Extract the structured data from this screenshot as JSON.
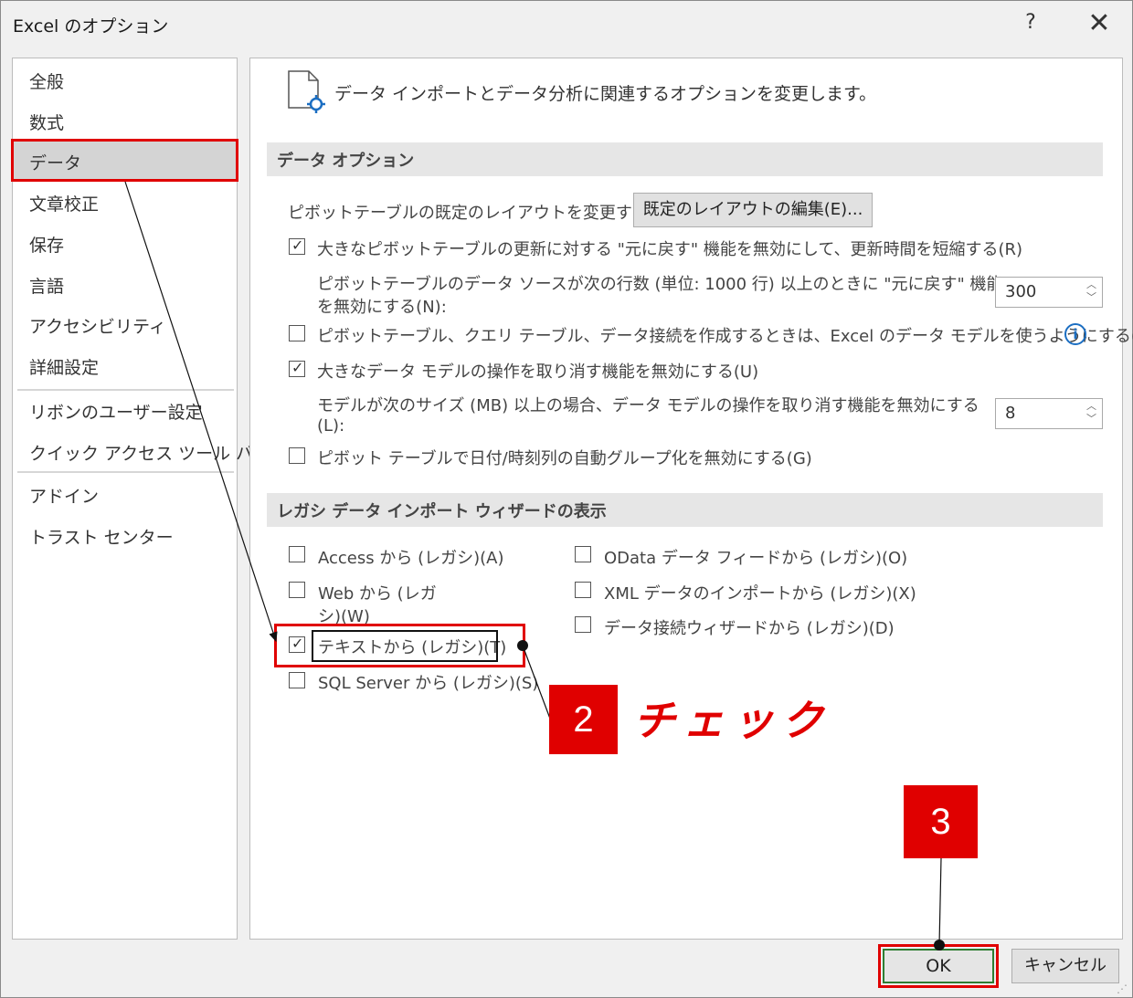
{
  "window": {
    "title": "Excel のオプション",
    "help": "?",
    "close": "✕"
  },
  "nav": {
    "items": [
      "全般",
      "数式",
      "データ",
      "文章校正",
      "保存",
      "言語",
      "アクセシビリティ",
      "詳細設定",
      "リボンのユーザー設定",
      "クイック アクセス ツール バー",
      "アドイン",
      "トラスト センター"
    ],
    "selected": "データ"
  },
  "header": {
    "text": "データ インポートとデータ分析に関連するオプションを変更します。",
    "icon": "data-options-icon"
  },
  "data_options": {
    "title": "データ オプション",
    "pivot_layout_label": "ピボットテーブルの既定のレイアウトを変更する:",
    "pivot_layout_button": "既定のレイアウトの編集(E)...",
    "disable_undo_large_pivot": {
      "label": "大きなピボットテーブルの更新に対する \"元に戻す\" 機能を無効にして、更新時間を短縮する(R)",
      "checked": true
    },
    "pivot_rows_label_line1": "ピボットテーブルのデータ ソースが次の行数 (単位: 1000 行) 以上のときに \"元に戻す\" 機能",
    "pivot_rows_label_line2": "を無効にする(N):",
    "pivot_rows_value": "300",
    "prefer_data_model": {
      "label": "ピボットテーブル、クエリ テーブル、データ接続を作成するときは、Excel のデータ モデルを使うようにする(M)",
      "checked": false
    },
    "disable_undo_data_model": {
      "label": "大きなデータ モデルの操作を取り消す機能を無効にする(U)",
      "checked": true
    },
    "model_size_label_line1": "モデルが次のサイズ (MB) 以上の場合、データ モデルの操作を取り消す機能を無効にする",
    "model_size_label_line2": "(L):",
    "model_size_value": "8",
    "disable_auto_grouping": {
      "label": "ピボット テーブルで日付/時刻列の自動グループ化を無効にする(G)",
      "checked": false
    }
  },
  "legacy": {
    "title": "レガシ データ インポート ウィザードの表示",
    "access": {
      "label": "Access から (レガシ)(A)",
      "checked": false
    },
    "web_line1": "Web から (レガ",
    "web_line2": "シ)(W)",
    "web_checked": false,
    "text": {
      "label": "テキストから (レガシ)(T)",
      "checked": true
    },
    "sql": {
      "label": "SQL Server から (レガシ)(S)",
      "checked": false
    },
    "odata": {
      "label": "OData データ フィードから (レガシ)(O)",
      "checked": false
    },
    "xml": {
      "label": "XML データのインポートから (レガシ)(X)",
      "checked": false
    },
    "wizard": {
      "label": "データ接続ウィザードから (レガシ)(D)",
      "checked": false
    }
  },
  "footer": {
    "ok": "OK",
    "cancel": "キャンセル"
  },
  "annotations": {
    "step2": "2",
    "step2_label": "チェック",
    "step3": "3"
  },
  "colors": {
    "highlight": "#e00000",
    "ok_border": "#2e7d32",
    "info": "#1b6ec2"
  }
}
